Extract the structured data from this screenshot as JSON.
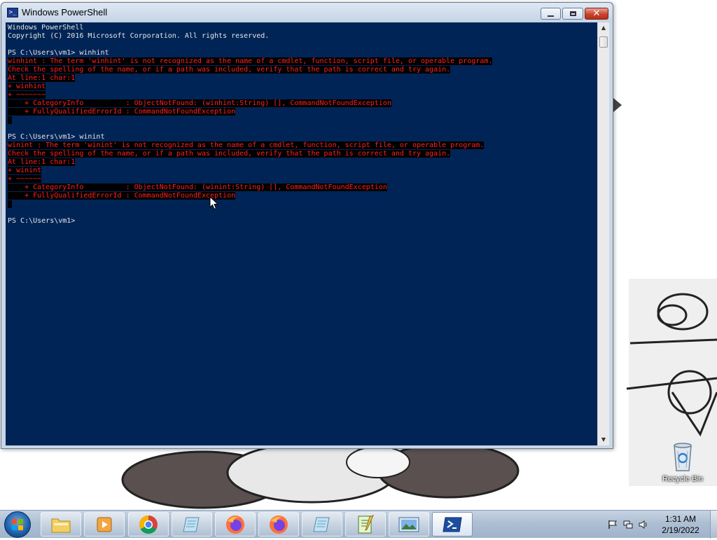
{
  "window": {
    "title": "Windows PowerShell",
    "icon": "powershell-icon"
  },
  "console": {
    "lines": [
      {
        "text": "Windows PowerShell",
        "kind": "normal"
      },
      {
        "text": "Copyright (C) 2016 Microsoft Corporation. All rights reserved.",
        "kind": "normal"
      },
      {
        "text": "",
        "kind": "normal"
      },
      {
        "text": "PS C:\\Users\\vm1> winhint",
        "kind": "normal"
      },
      {
        "text": "winhint : The term 'winhint' is not recognized as the name of a cmdlet, function, script file, or operable program.",
        "kind": "error"
      },
      {
        "text": "Check the spelling of the name, or if a path was included, verify that the path is correct and try again.",
        "kind": "error"
      },
      {
        "text": "At line:1 char:1",
        "kind": "error"
      },
      {
        "text": "+ winhint",
        "kind": "error"
      },
      {
        "text": "+ ~~~~~~~",
        "kind": "error"
      },
      {
        "text": "    + CategoryInfo          : ObjectNotFound: (winhint:String) [], CommandNotFoundException",
        "kind": "error"
      },
      {
        "text": "    + FullyQualifiedErrorId : CommandNotFoundException",
        "kind": "error"
      },
      {
        "text": " ",
        "kind": "error"
      },
      {
        "text": "",
        "kind": "normal"
      },
      {
        "text": "PS C:\\Users\\vm1> winint",
        "kind": "normal"
      },
      {
        "text": "winint : The term 'winint' is not recognized as the name of a cmdlet, function, script file, or operable program.",
        "kind": "error"
      },
      {
        "text": "Check the spelling of the name, or if a path was included, verify that the path is correct and try again.",
        "kind": "error"
      },
      {
        "text": "At line:1 char:1",
        "kind": "error"
      },
      {
        "text": "+ winint",
        "kind": "error"
      },
      {
        "text": "+ ~~~~~~",
        "kind": "error"
      },
      {
        "text": "    + CategoryInfo          : ObjectNotFound: (winint:String) [], CommandNotFoundException",
        "kind": "error"
      },
      {
        "text": "    + FullyQualifiedErrorId : CommandNotFoundException",
        "kind": "error"
      },
      {
        "text": " ",
        "kind": "error"
      },
      {
        "text": "",
        "kind": "normal"
      },
      {
        "text": "PS C:\\Users\\vm1>",
        "kind": "normal"
      }
    ]
  },
  "desktop": {
    "recycle_bin_label": "Recycle Bin"
  },
  "taskbar": {
    "items": [
      {
        "name": "explorer",
        "icon": "folder-icon",
        "active": false
      },
      {
        "name": "media-player",
        "icon": "media-player-icon",
        "active": false
      },
      {
        "name": "chrome",
        "icon": "chrome-icon",
        "active": false
      },
      {
        "name": "notepad",
        "icon": "notepad-icon",
        "active": false
      },
      {
        "name": "firefox-1",
        "icon": "firefox-icon",
        "active": false
      },
      {
        "name": "firefox-2",
        "icon": "firefox-icon",
        "active": false
      },
      {
        "name": "notepad-2",
        "icon": "notepad-icon",
        "active": false
      },
      {
        "name": "editor",
        "icon": "text-editor-icon",
        "active": false
      },
      {
        "name": "image-viewer",
        "icon": "image-viewer-icon",
        "active": false
      },
      {
        "name": "powershell",
        "icon": "powershell-icon",
        "active": true
      }
    ],
    "clock": {
      "time": "1:31 AM",
      "date": "2/19/2022"
    }
  },
  "colors": {
    "console_bg": "#012456",
    "console_fg": "#e6e6e6",
    "error_fg": "#ff2020",
    "error_bg": "#000000"
  }
}
